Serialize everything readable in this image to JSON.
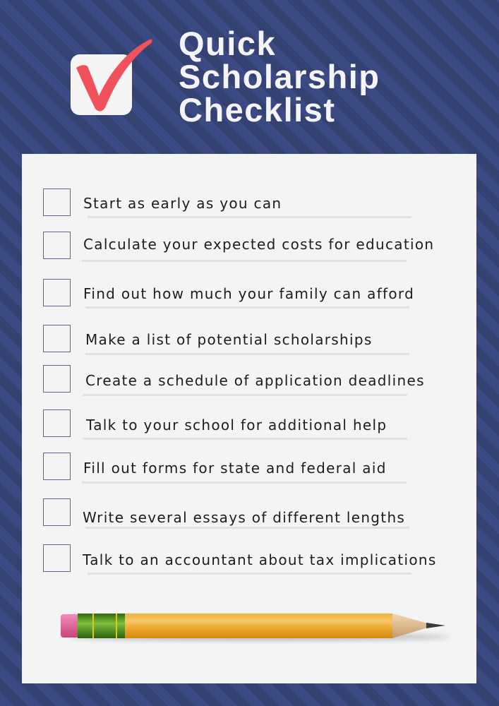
{
  "header": {
    "logo_icon": "checked-checkbox-icon",
    "title_lines": [
      "Quick",
      "Scholarship",
      "Checklist"
    ]
  },
  "checklist": {
    "items": [
      {
        "label": "Start as early as you can",
        "checked": false
      },
      {
        "label": "Calculate your expected costs for education",
        "checked": false
      },
      {
        "label": "Find out how much your family can afford",
        "checked": false
      },
      {
        "label": "Make a list of potential scholarships",
        "checked": false
      },
      {
        "label": "Create a schedule of application deadlines",
        "checked": false
      },
      {
        "label": "Talk to your school for additional help",
        "checked": false
      },
      {
        "label": "Fill out forms for state and federal aid",
        "checked": false
      },
      {
        "label": "Write several essays of different lengths",
        "checked": false
      },
      {
        "label": "Talk to an accountant about tax implications",
        "checked": false
      }
    ]
  },
  "decoration": {
    "footer_icon": "pencil-icon"
  },
  "colors": {
    "background_stripe_light": "#3b4a82",
    "background_stripe_dark": "#334271",
    "panel": "#f4f4f4",
    "checkmark": "#f0515b",
    "checkbox_border": "#5d6799",
    "title_text": "#f4f4f6"
  }
}
